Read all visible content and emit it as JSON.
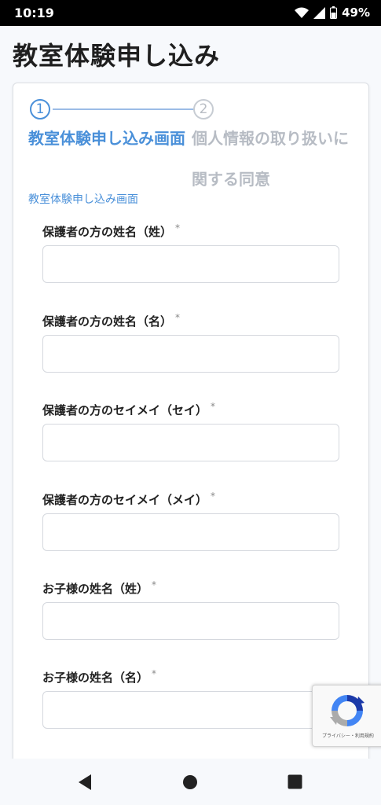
{
  "status_bar": {
    "time": "10:19",
    "battery": "49%",
    "icons": [
      "wifi-icon",
      "signal-icon",
      "battery-icon"
    ]
  },
  "page": {
    "title": "教室体験申し込み"
  },
  "stepper": {
    "steps": [
      {
        "number": "1",
        "label": "教室体験申し込み画面",
        "active": true
      },
      {
        "number": "2",
        "label": "個人情報の取り扱いに関する同意",
        "active": false
      }
    ],
    "current_caption": "教室体験申し込み画面"
  },
  "form": {
    "required_mark": "*",
    "fields": [
      {
        "label": "保護者の方の姓名（姓）",
        "value": ""
      },
      {
        "label": "保護者の方の姓名（名）",
        "value": ""
      },
      {
        "label": "保護者の方のセイメイ（セイ）",
        "value": ""
      },
      {
        "label": "保護者の方のセイメイ（メイ）",
        "value": ""
      },
      {
        "label": "お子様の姓名（姓）",
        "value": ""
      },
      {
        "label": "お子様の姓名（名）",
        "value": ""
      }
    ]
  },
  "recaptcha": {
    "terms": "プライバシー・利用規約"
  },
  "colors": {
    "accent": "#4a90d9",
    "inactive": "#b7bcc4"
  }
}
